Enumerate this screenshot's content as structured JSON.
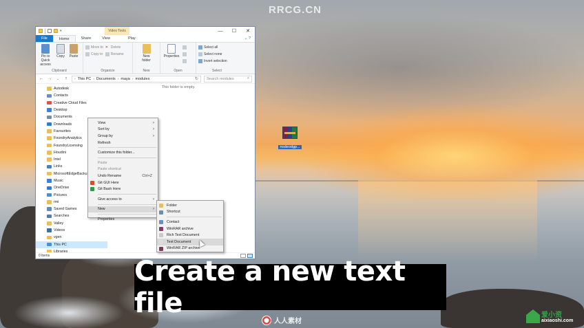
{
  "watermark": "RRCG.CN",
  "desktop_icon": {
    "label": "nodeodgp...",
    "icon": "winrar-archive-icon"
  },
  "window": {
    "context_tab": "Video Tools",
    "controls": {
      "minimize": "—",
      "maximize": "☐",
      "close": "✕"
    },
    "tabs": [
      "File",
      "Home",
      "Share",
      "View",
      "Play"
    ],
    "ribbon": {
      "clipboard": {
        "label": "Clipboard",
        "pin": "Pin to Quick access",
        "copy": "Copy",
        "paste": "Paste"
      },
      "organize": {
        "label": "Organize",
        "move_to": "Move to",
        "copy_to": "Copy to",
        "delete": "Delete",
        "rename": "Rename"
      },
      "new": {
        "label": "New",
        "new_folder": "New folder"
      },
      "open": {
        "label": "Open",
        "properties": "Properties"
      },
      "select": {
        "label": "Select",
        "select_all": "Select all",
        "select_none": "Select none",
        "invert": "Invert selection"
      }
    },
    "breadcrumb": [
      "This PC",
      "Documents",
      "maya",
      "modules"
    ],
    "search_placeholder": "Search modules",
    "empty_message": "This folder is empty.",
    "status": "0 items",
    "nav_items": [
      {
        "label": "Autodesk",
        "color": "#e8c05a"
      },
      {
        "label": "Contacts",
        "color": "#6b8fbf"
      },
      {
        "label": "Creative Cloud Files",
        "color": "#d9534f"
      },
      {
        "label": "Desktop",
        "color": "#3f7fcf"
      },
      {
        "label": "Documents",
        "color": "#7a8ba0"
      },
      {
        "label": "Downloads",
        "color": "#2f7ad1"
      },
      {
        "label": "Favourites",
        "color": "#e8c05a"
      },
      {
        "label": "FoundryAnalytics",
        "color": "#e8c05a"
      },
      {
        "label": "FoundryLicensing",
        "color": "#e8c05a"
      },
      {
        "label": "Houdini",
        "color": "#e8c05a"
      },
      {
        "label": "Intel",
        "color": "#e8c05a"
      },
      {
        "label": "Links",
        "color": "#4a7fc0"
      },
      {
        "label": "MicrosoftEdgeBackup",
        "color": "#e8c05a"
      },
      {
        "label": "Music",
        "color": "#3f7fcf"
      },
      {
        "label": "OneDrive",
        "color": "#2f7ad1"
      },
      {
        "label": "Pictures",
        "color": "#4a8fcf"
      },
      {
        "label": "rmi",
        "color": "#e8c05a"
      },
      {
        "label": "Saved Games",
        "color": "#6a8bb0"
      },
      {
        "label": "Searches",
        "color": "#5a7aa0"
      },
      {
        "label": "Valley",
        "color": "#e8c05a"
      },
      {
        "label": "Videos",
        "color": "#3f6fa0"
      },
      {
        "label": "vgen",
        "color": "#e8c05a"
      },
      {
        "label": "This PC",
        "color": "#4a8fcf"
      },
      {
        "label": "Libraries",
        "color": "#e8c05a"
      }
    ]
  },
  "context_menu": {
    "items": [
      {
        "label": "View",
        "arrow": "›"
      },
      {
        "label": "Sort by",
        "arrow": "›"
      },
      {
        "label": "Group by",
        "arrow": "›"
      },
      {
        "label": "Refresh"
      },
      {
        "sep": true
      },
      {
        "label": "Customize this folder..."
      },
      {
        "sep": true
      },
      {
        "label": "Paste",
        "disabled": true
      },
      {
        "label": "Paste shortcut",
        "disabled": true
      },
      {
        "label": "Undo Rename",
        "shortcut": "Ctrl+Z"
      },
      {
        "label": "Git GUI Here",
        "icon": "git-gui-icon",
        "icon_color": "#d54c2f"
      },
      {
        "label": "Git Bash Here",
        "icon": "git-bash-icon",
        "icon_color": "#2f9a4a"
      },
      {
        "sep": true
      },
      {
        "label": "Give access to",
        "arrow": "›"
      },
      {
        "sep": true
      },
      {
        "label": "New",
        "arrow": "›",
        "highlight": true
      },
      {
        "sep": true
      },
      {
        "label": "Properties"
      }
    ]
  },
  "submenu_new": {
    "items": [
      {
        "label": "Folder",
        "icon": "folder-icon",
        "icon_color": "#e8c05a"
      },
      {
        "label": "Shortcut",
        "icon": "shortcut-icon",
        "icon_color": "#6f8fb0"
      },
      {
        "sep": true
      },
      {
        "label": "Contact",
        "icon": "contact-icon",
        "icon_color": "#6b8fbf"
      },
      {
        "label": "WinRAR archive",
        "icon": "winrar-icon",
        "icon_color": "#8a3a6a"
      },
      {
        "label": "Rich Text Document",
        "icon": "rtf-icon",
        "icon_color": "#c9c9c9"
      },
      {
        "label": "Text Document",
        "icon": "txt-icon",
        "icon_color": "#dcdcdc",
        "highlight": true
      },
      {
        "label": "WinRAR ZIP archive",
        "icon": "zip-icon",
        "icon_color": "#7a3a5a"
      }
    ]
  },
  "caption": "Create a new text file",
  "logo_center": "人人素材",
  "logo_right": {
    "brand": "爱小资",
    "url": "aixiaoshi.com"
  }
}
